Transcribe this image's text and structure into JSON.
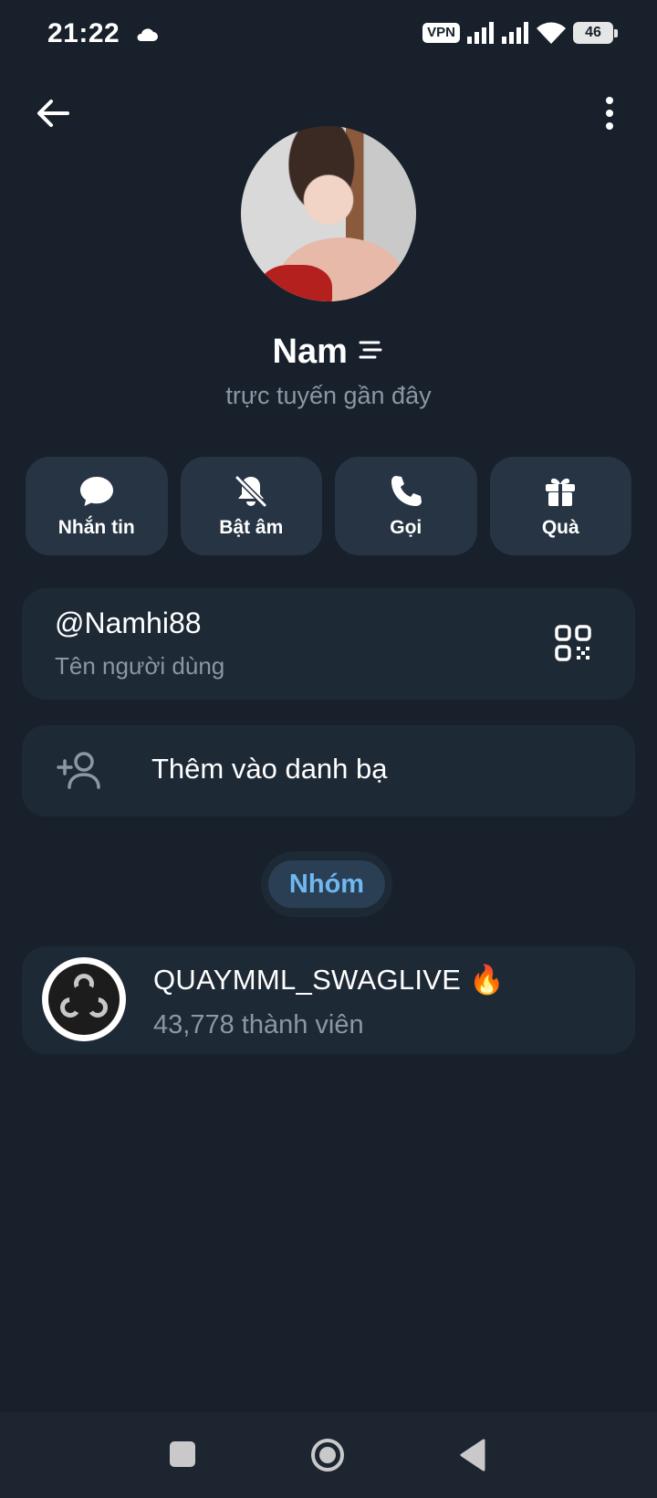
{
  "status_bar": {
    "time": "21:22",
    "vpn": "VPN",
    "battery": "46"
  },
  "profile": {
    "name": "Nam ",
    "status": "trực tuyến gần đây"
  },
  "actions": [
    {
      "label": "Nhắn tin",
      "icon": "chat-bubble-icon"
    },
    {
      "label": "Bật âm",
      "icon": "bell-off-icon"
    },
    {
      "label": "Gọi",
      "icon": "phone-icon"
    },
    {
      "label": "Quà",
      "icon": "gift-icon"
    }
  ],
  "username": {
    "value": "@Namhi88",
    "label": "Tên người dùng"
  },
  "add_contact": {
    "label": "Thêm vào danh bạ"
  },
  "groups_chip": "Nhóm",
  "group": {
    "name": "QUAYMML_SWAGLIVE 🔥",
    "members": "43,778 thành viên"
  },
  "colors": {
    "background": "#17202b",
    "card": "#1e2936",
    "accent": "#70b8f0"
  }
}
